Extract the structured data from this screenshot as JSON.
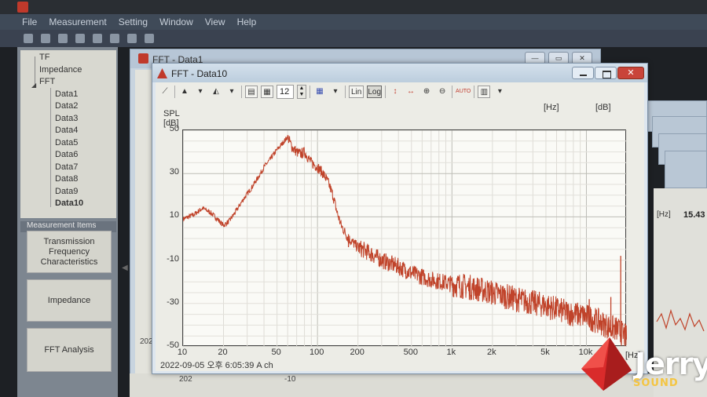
{
  "menubar": [
    "File",
    "Measurement",
    "Setting",
    "Window",
    "View",
    "Help"
  ],
  "tree": {
    "top": [
      "TF",
      "Impedance",
      "FFT"
    ],
    "children": [
      "Data1",
      "Data2",
      "Data3",
      "Data4",
      "Data5",
      "Data6",
      "Data7",
      "Data8",
      "Data9",
      "Data10"
    ],
    "selected": "Data10"
  },
  "measurement": {
    "header": "Measurement Items",
    "buttons": [
      "Transmission Frequency Characteristics",
      "Impedance",
      "FFT Analysis"
    ]
  },
  "back_window": {
    "title": "FFT - Data1",
    "bottom_label": "202"
  },
  "right_panel": {
    "unit": "[Hz]",
    "value": "15.43"
  },
  "bottom_labels": {
    "b1": "202",
    "b2": "-10"
  },
  "main_window": {
    "title": "FFT - Data10",
    "close_glyph": "✕",
    "toolbar": {
      "font_size": "12",
      "lin": "Lin",
      "log": "Log",
      "auto": "AUTO"
    },
    "unit_hz": "[Hz]",
    "unit_db": "[dB]",
    "status": "2022-09-05 오후 6:05:39   A ch"
  },
  "chart_data": {
    "type": "line",
    "ylabel": "SPL\n[dB]",
    "xlabel": "[Hz]",
    "x_scale": "log",
    "xlim": [
      10,
      20000
    ],
    "ylim": [
      -50,
      50
    ],
    "y_ticks": [
      "50",
      "30",
      "10",
      "-10",
      "-30",
      "-50"
    ],
    "x_ticks": [
      "10",
      "20",
      "50",
      "100",
      "200",
      "500",
      "1k",
      "2k",
      "5k",
      "10k",
      "20k"
    ],
    "x_tick_values": [
      10,
      20,
      50,
      100,
      200,
      500,
      1000,
      2000,
      5000,
      10000,
      20000
    ],
    "grid": true,
    "line_color": "#c0432a",
    "series": [
      {
        "x": [
          10,
          12,
          14,
          16,
          18,
          20,
          22,
          25,
          28,
          32,
          36,
          40,
          45,
          50,
          55,
          60,
          65,
          70,
          75,
          80,
          90,
          100,
          110,
          120,
          130,
          140,
          150,
          170,
          200,
          250,
          300,
          400,
          500,
          700,
          1000,
          1500,
          2000,
          3000,
          5000,
          7000,
          10000,
          12000,
          15000,
          17000,
          18500,
          20000
        ],
        "y": [
          9,
          11,
          14,
          12,
          9,
          6,
          8,
          13,
          18,
          23,
          28,
          33,
          37,
          41,
          44,
          47,
          42,
          40,
          39,
          40,
          35,
          33,
          30,
          26,
          20,
          12,
          6,
          0,
          -4,
          -7,
          -10,
          -13,
          -16,
          -19,
          -21,
          -23,
          -25,
          -28,
          -31,
          -34,
          -36,
          -38,
          -41,
          -42,
          -44,
          -46
        ]
      }
    ],
    "spikes": [
      {
        "x": 170,
        "y": 2
      },
      {
        "x": 10500,
        "y": -28
      },
      {
        "x": 15200,
        "y": -27
      },
      {
        "x": 18000,
        "y": -8
      }
    ]
  },
  "logo": {
    "name": "Jerry",
    "sub": "SOUND"
  }
}
